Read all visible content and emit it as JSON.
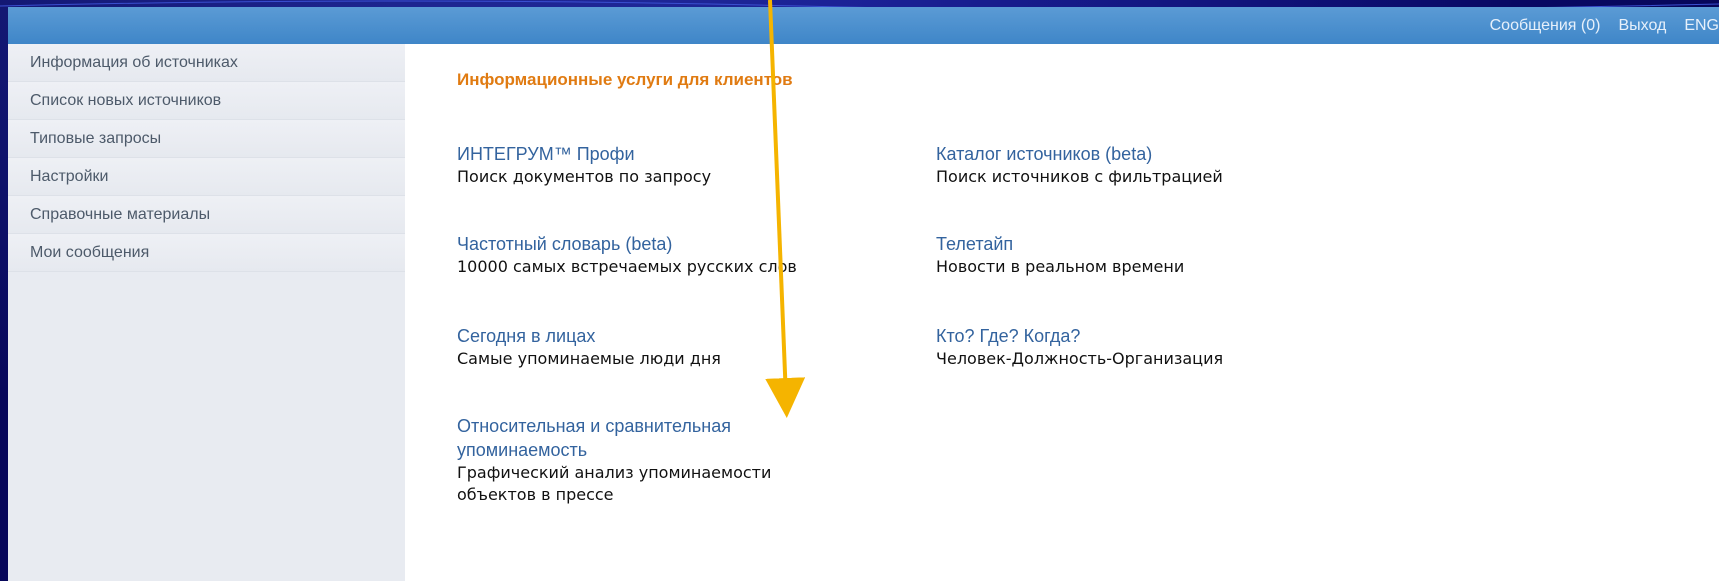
{
  "header": {
    "links": [
      "Сообщения (0)",
      "Выход",
      "ENG"
    ]
  },
  "sidebar": {
    "items": [
      {
        "label": "Информация об источниках"
      },
      {
        "label": "Список новых источников"
      },
      {
        "label": "Типовые запросы"
      },
      {
        "label": "Настройки"
      },
      {
        "label": "Справочные материалы"
      },
      {
        "label": "Мои сообщения"
      }
    ]
  },
  "main": {
    "title": "Информационные услуги для клиентов",
    "left_services": [
      {
        "link": "ИНТЕГРУМ™ Профи",
        "desc": "Поиск документов по запросу"
      },
      {
        "link": "Частотный словарь (beta)",
        "desc": "10000 самых встречаемых русских слов"
      },
      {
        "link": "Сегодня в лицах",
        "desc": "Самые упоминаемые люди дня"
      },
      {
        "link": "Относительная и сравнительная упоминаемость",
        "desc": "Графический анализ упоминаемости объектов в прессе"
      }
    ],
    "right_services": [
      {
        "link": "Каталог источников (beta)",
        "desc": "Поиск источников с фильтрацией"
      },
      {
        "link": "Телетайп",
        "desc": "Новости в реальном времени"
      },
      {
        "link": "Кто? Где? Когда?",
        "desc": "Человек-Должность-Организация"
      }
    ]
  },
  "annotation": {
    "arrow_color": "#f5b400"
  }
}
